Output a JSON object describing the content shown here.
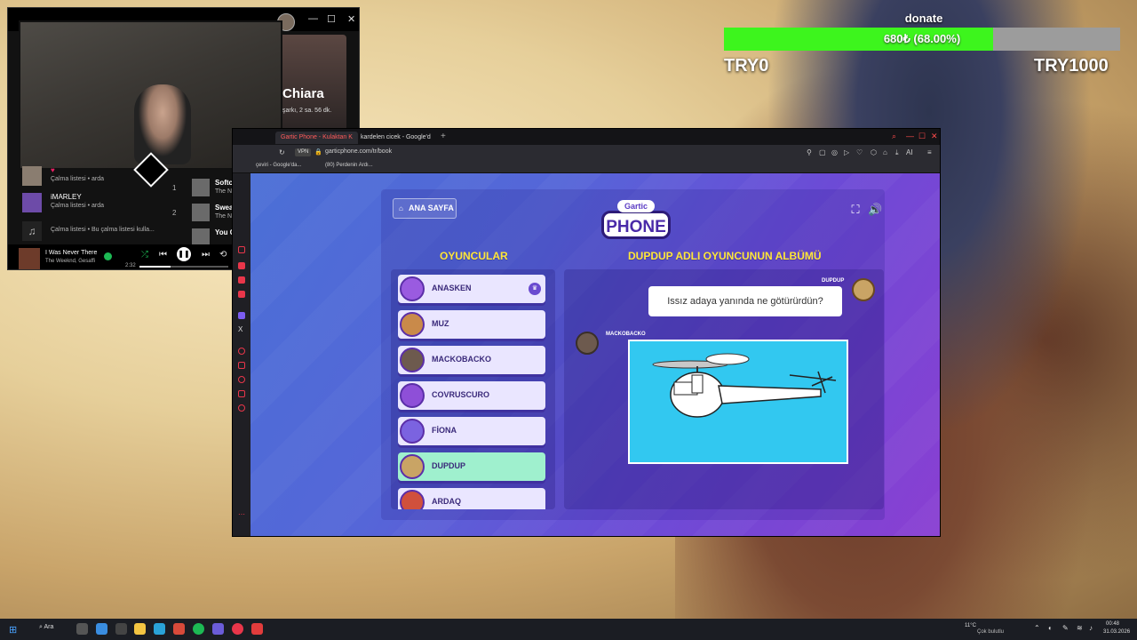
{
  "donate": {
    "title": "donate",
    "progress_text": "680₺ (68.00%)",
    "progress_fraction": 0.68,
    "min_label": "TRY0",
    "max_label": "TRY1000",
    "fill_color": "#3df51d"
  },
  "spotify": {
    "playlist_title": "Chiara",
    "playlist_sub": "şarkı, 2 sa. 56 dk.",
    "library": [
      {
        "title": "",
        "sub": "Çalma listesi • arda"
      },
      {
        "title": "iMARLEY",
        "sub": "Çalma listesi • arda"
      },
      {
        "title": "",
        "sub": "Çalma listesi • Bu çalma listesi kulla..."
      }
    ],
    "tracks": [
      {
        "num": "1",
        "title": "Softcore",
        "sub": "The Neig"
      },
      {
        "num": "2",
        "title": "Sweater",
        "sub": "The N"
      },
      {
        "num": "",
        "title": "You Get",
        "sub": ""
      }
    ],
    "now_playing": {
      "title": "I Was Never There",
      "artist": "The Weeknd, Gesaffi",
      "time": "2:32",
      "progress_fraction": 0.35
    }
  },
  "browser": {
    "tabs": [
      {
        "label": "Gartic Phone - Kulaktan K"
      },
      {
        "label": "kardelen cicek - Google'd"
      }
    ],
    "vpn": "VPN",
    "url": "garticphone.com/tr/book",
    "bookmarks": [
      "çeviri - Google'da...",
      "(80) Perdenin Ardı..."
    ],
    "ai_label": "AI"
  },
  "gartic": {
    "home_button": "ANA SAYFA",
    "logo_top": "Gartic",
    "logo_main": "PHONE",
    "players_title": "OYUNCULAR",
    "album_title": "DUPDUP ADLI OYUNCUNUN ALBÜMÜ",
    "players": [
      {
        "name": "ANASKEN",
        "host": true,
        "current": false
      },
      {
        "name": "MUZ",
        "host": false,
        "current": false
      },
      {
        "name": "MACKOBACKO",
        "host": false,
        "current": false
      },
      {
        "name": "COVRUSCURO",
        "host": false,
        "current": false
      },
      {
        "name": "FİONA",
        "host": false,
        "current": false
      },
      {
        "name": "DUPDUP",
        "host": false,
        "current": true
      },
      {
        "name": "ARDAQ",
        "host": false,
        "current": false
      }
    ],
    "album": {
      "prompt_author": "DUPDUP",
      "prompt_text": "Issız adaya yanında ne götürürdün?",
      "drawing_author": "MACKOBACKO"
    }
  },
  "taskbar": {
    "search_label": "Ara",
    "weather_temp": "11°C",
    "weather_desc": "Çok bulutlu",
    "time": "00:48",
    "date": "31.03.2026"
  }
}
